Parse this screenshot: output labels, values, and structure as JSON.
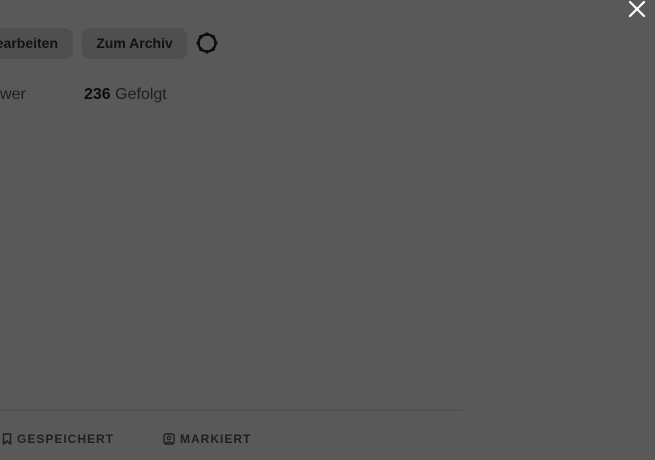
{
  "profile": {
    "edit_button_label": "earbeiten",
    "archive_button_label": "Zum Archiv",
    "settings_icon": "gear-icon"
  },
  "stats": {
    "followers_label": "llower",
    "following_count": "236",
    "following_label": "Gefolgt"
  },
  "tabs": [
    {
      "label": "GESPEICHERT",
      "icon": "bookmark-icon"
    },
    {
      "label": "MARKIERT",
      "icon": "tagged-user-icon"
    }
  ],
  "overlay": {
    "close_icon": "close-icon",
    "background_color": "#595959"
  }
}
